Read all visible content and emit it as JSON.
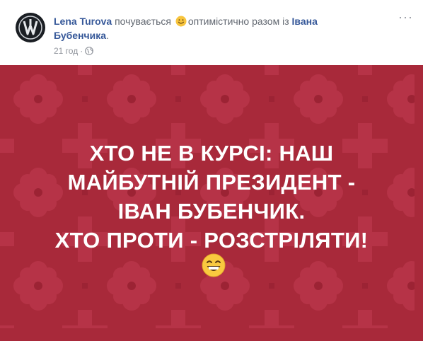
{
  "post": {
    "author": "Lena Turova",
    "feeling_text": "почувається",
    "feeling_word": "оптимістично",
    "with_text": "разом із",
    "tagged_person_line1": "Івана",
    "tagged_person_line2": "Бубенчика",
    "tagged_suffix": ".",
    "timestamp": "21 год",
    "dot": "·",
    "privacy_icon": "globe-icon",
    "menu_icon": "more-options-icon",
    "menu_glyph": "···"
  },
  "image": {
    "lines": [
      "ХТО НЕ В КУРСІ: НАШ",
      "МАЙБУТНІЙ ПРЕЗИДЕНТ -",
      "ІВАН БУБЕНЧИК.",
      "ХТО ПРОТИ - РОЗСТРІЛЯТИ!"
    ],
    "emoji": "grinning-smiling-eyes-emoji",
    "background_color": "#a8293a",
    "pattern_color": "#b63347"
  },
  "colors": {
    "link": "#365899",
    "meta": "#616770",
    "subtle": "#90949c"
  }
}
